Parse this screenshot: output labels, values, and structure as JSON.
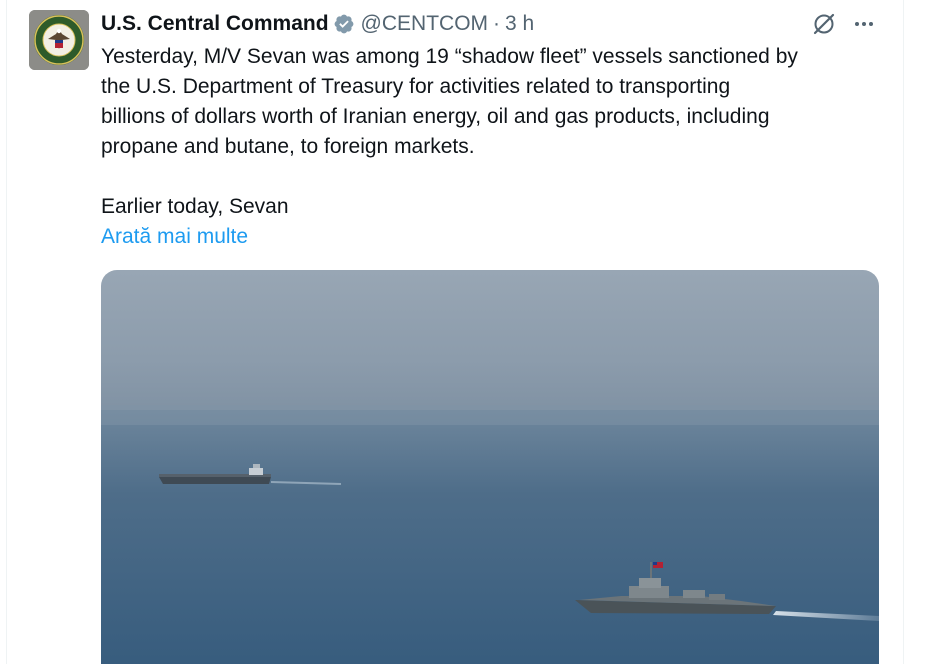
{
  "tweet": {
    "display_name": "U.S. Central Command",
    "handle": "@CENTCOM",
    "separator": "·",
    "time": "3 h",
    "text": "Yesterday, M/V Sevan was among 19 “shadow fleet” vessels sanctioned by\nthe U.S. Department of Treasury for activities related to transporting\nbillions of dollars worth of Iranian energy, oil and gas products, including\npropane and butane, to foreign markets.\n\nEarlier today, Sevan",
    "show_more": "Arată mai multe"
  },
  "colors": {
    "text": "#0f1419",
    "secondary": "#536471",
    "link": "#1d9bf0",
    "verified_badge": "#829aab"
  },
  "icons": {
    "verified": "verified-badge-icon",
    "grok": "grok-icon",
    "more": "more-options-icon"
  }
}
